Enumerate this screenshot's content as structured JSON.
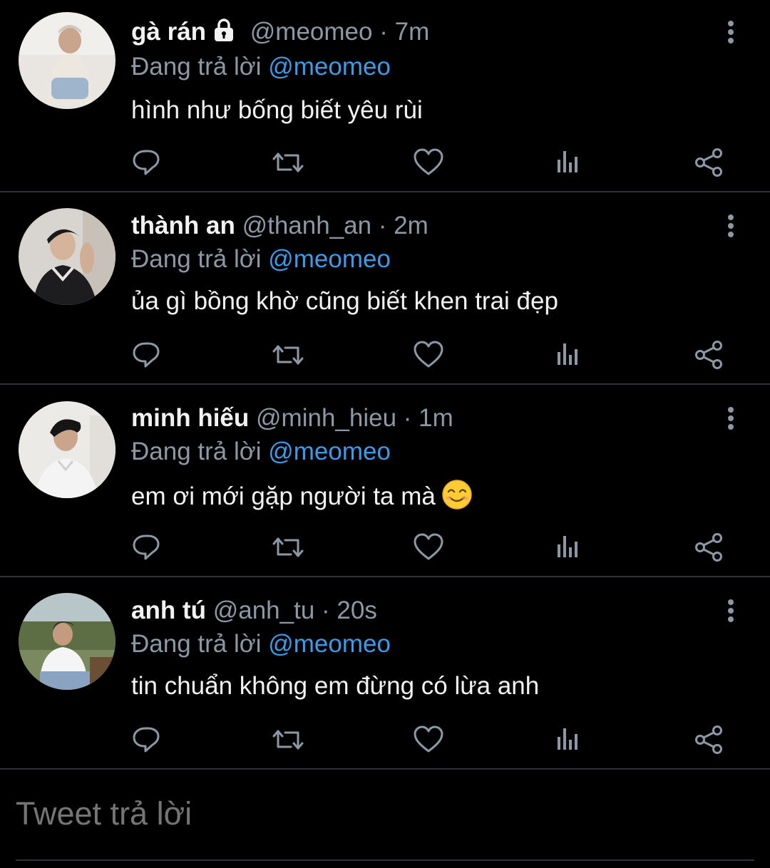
{
  "replying_prefix": "Đang trả lời",
  "colors": {
    "background": "#000000",
    "mention": "#3b9be8",
    "muted": "#8b98a5",
    "text": "#f2f2f2",
    "divider": "#2f3336"
  },
  "tweets": [
    {
      "name": "gà rán",
      "handle": "@meomeo",
      "time": "· 7m",
      "locked": true,
      "mention": "@meomeo",
      "text": "hình như bống biết yêu rùi"
    },
    {
      "name": "thành an",
      "handle": "@thanh_an",
      "time": "· 2m",
      "locked": false,
      "mention": "@meomeo",
      "text": "ủa gì bồng khờ cũng biết khen trai đẹp"
    },
    {
      "name": "minh hiếu",
      "handle": "@minh_hieu",
      "time": "· 1m",
      "locked": false,
      "mention": "@meomeo",
      "text": "em ơi mới gặp người ta mà",
      "emoji": "smiling-face-emoji"
    },
    {
      "name": "anh tú",
      "handle": "@anh_tu",
      "time": "· 20s",
      "locked": false,
      "mention": "@meomeo",
      "text": "tin chuẩn không em đừng có lừa anh"
    }
  ],
  "action_icons": [
    "reply-icon",
    "retweet-icon",
    "like-icon",
    "analytics-icon",
    "share-icon"
  ],
  "compose": {
    "placeholder": "Tweet trả lời"
  }
}
